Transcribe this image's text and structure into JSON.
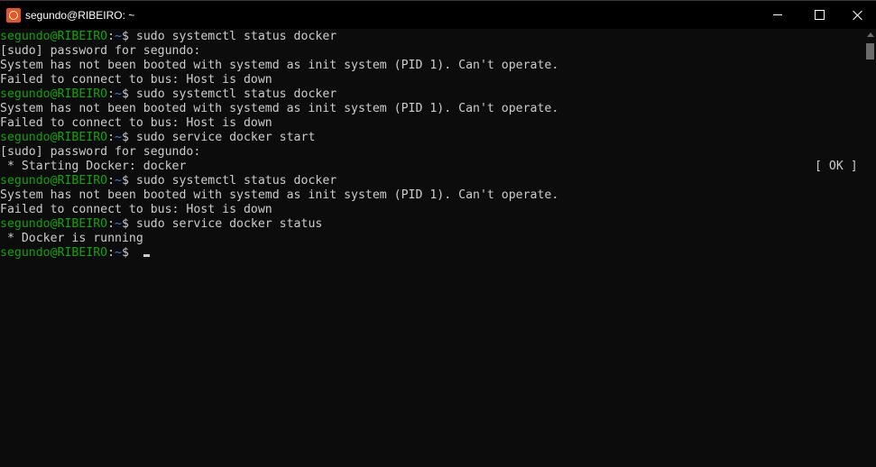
{
  "window": {
    "title": "segundo@RIBEIRO: ~",
    "icon": "ubuntu-icon",
    "controls": [
      "minimize-icon",
      "maximize-icon",
      "close-icon"
    ]
  },
  "prompt": {
    "user_host": "segundo@RIBEIRO",
    "colon": ":",
    "path": "~",
    "symbol": "$ "
  },
  "lines": [
    {
      "type": "cmd",
      "cmd": "sudo systemctl status docker"
    },
    {
      "type": "out",
      "text": "[sudo] password for segundo:"
    },
    {
      "type": "out",
      "text": "System has not been booted with systemd as init system (PID 1). Can't operate."
    },
    {
      "type": "out",
      "text": "Failed to connect to bus: Host is down"
    },
    {
      "type": "cmd",
      "cmd": "sudo systemctl status docker"
    },
    {
      "type": "out",
      "text": "System has not been booted with systemd as init system (PID 1). Can't operate."
    },
    {
      "type": "out",
      "text": "Failed to connect to bus: Host is down"
    },
    {
      "type": "cmd",
      "cmd": "sudo service docker start"
    },
    {
      "type": "out",
      "text": "[sudo] password for segundo:"
    },
    {
      "type": "out",
      "text": " * Starting Docker: docker",
      "status": "[ OK ]"
    },
    {
      "type": "cmd",
      "cmd": "sudo systemctl status docker"
    },
    {
      "type": "out",
      "text": "System has not been booted with systemd as init system (PID 1). Can't operate."
    },
    {
      "type": "out",
      "text": "Failed to connect to bus: Host is down"
    },
    {
      "type": "cmd",
      "cmd": "sudo service docker status"
    },
    {
      "type": "out",
      "text": " * Docker is running"
    },
    {
      "type": "prompt",
      "cmd": ""
    }
  ],
  "colors": {
    "background": "#0c0c0c",
    "text": "#cccccc",
    "user_host": "#13a10e",
    "path": "#3b78ff",
    "titlebar": "#000000",
    "ubuntu_orange": "#e95420"
  }
}
